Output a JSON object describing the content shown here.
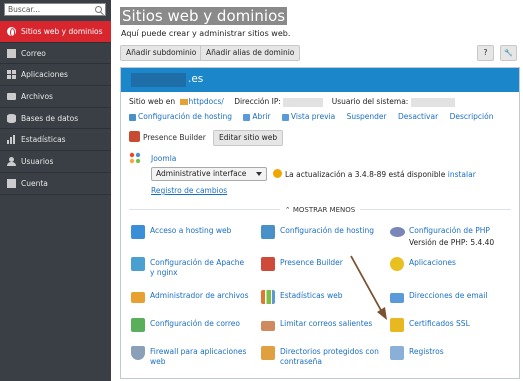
{
  "sidebar": {
    "search_placeholder": "Buscar...",
    "items": [
      {
        "label": "Sitios web y dominios",
        "icon": "globe-icon",
        "active": true
      },
      {
        "label": "Correo",
        "icon": "mail-icon"
      },
      {
        "label": "Aplicaciones",
        "icon": "apps-grid-icon"
      },
      {
        "label": "Archivos",
        "icon": "folder-icon"
      },
      {
        "label": "Bases de datos",
        "icon": "database-icon"
      },
      {
        "label": "Estadísticas",
        "icon": "bar-chart-icon"
      },
      {
        "label": "Usuarios",
        "icon": "user-icon"
      },
      {
        "label": "Cuenta",
        "icon": "account-icon"
      }
    ]
  },
  "page": {
    "title": "Sitios web y dominios",
    "subtitle": "Aquí puede crear y administrar sitios web.",
    "add_subdomain": "Añadir subdominio",
    "add_alias": "Añadir alias de dominio",
    "help": "?",
    "tools": "🔧"
  },
  "site": {
    "domain": ".es",
    "website_at_label": "Sitio web en",
    "website_at_link": "httpdocs/",
    "ip_label": "Dirección IP:",
    "sysuser_label": "Usuario del sistema:",
    "actions": [
      "Configuración de hosting",
      "Abrir",
      "Vista previa",
      "Suspender",
      "Desactivar",
      "Descripción"
    ],
    "presence_builder": "Presence Builder",
    "edit_site": "Editar sitio web",
    "app_name": "Joomla",
    "interface_select": "Administrative interface",
    "update_text": "La actualización a 3.4.8-89 está disponible",
    "install_link": "instalar",
    "changelog_link": "Registro de cambios",
    "show_less": "⌃ MOSTRAR MENOS",
    "grid": [
      {
        "label": "Acceso a hosting web",
        "icon": "hosting-access-icon",
        "color": "#3b8ed8"
      },
      {
        "label": "Configuración de hosting",
        "icon": "hosting-settings-icon",
        "color": "#4a90c8"
      },
      {
        "label": "Configuración de PHP",
        "icon": "php-icon",
        "color": "#7a86b8",
        "extra": "Versión de PHP: 5.4.40"
      },
      {
        "label": "Configuración de Apache y nginx",
        "icon": "apache-icon",
        "color": "#4aa0d0"
      },
      {
        "label": "Presence Builder",
        "icon": "presence-builder-icon",
        "color": "#d04a3a"
      },
      {
        "label": "Aplicaciones",
        "icon": "applications-icon",
        "color": "#e8c020"
      },
      {
        "label": "Administrador de archivos",
        "icon": "file-manager-icon",
        "color": "#e8a030"
      },
      {
        "label": "Estadísticas web",
        "icon": "web-stats-icon",
        "color": "#e07830"
      },
      {
        "label": "Direcciones de email",
        "icon": "email-address-icon",
        "color": "#5a9ad8"
      },
      {
        "label": "Configuración de correo",
        "icon": "mail-settings-icon",
        "color": "#5ab05a"
      },
      {
        "label": "Limitar correos salientes",
        "icon": "limit-mail-icon",
        "color": "#d08a60"
      },
      {
        "label": "Certificados SSL",
        "icon": "ssl-icon",
        "color": "#e8b820"
      },
      {
        "label": "Firewall para aplicaciones web",
        "icon": "firewall-icon",
        "color": "#8aa0b8"
      },
      {
        "label": "Directorios protegidos con contraseña",
        "icon": "protected-dirs-icon",
        "color": "#e0a040"
      },
      {
        "label": "Registros",
        "icon": "logs-icon",
        "color": "#8ab0d8"
      }
    ]
  },
  "colors": {
    "accent": "#d8262f",
    "header": "#1b86c9",
    "link": "#1b6fc1",
    "sidebar": "#3a3f45"
  }
}
